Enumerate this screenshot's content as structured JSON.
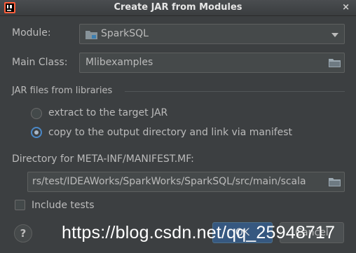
{
  "dialog": {
    "title": "Create JAR from Modules",
    "close_glyph": "×"
  },
  "module": {
    "label": "Module:",
    "value": "SparkSQL"
  },
  "main_class": {
    "label": "Main Class:",
    "value": "Mlibexamples"
  },
  "libraries": {
    "section_title": "JAR files from libraries",
    "options": [
      {
        "label": "extract to the target JAR",
        "selected": false
      },
      {
        "label": "copy to the output directory and link via manifest",
        "selected": true
      }
    ]
  },
  "manifest": {
    "label": "Directory for META-INF/MANIFEST.MF:",
    "value": "rs/test/IDEAWorks/SparkWorks/SparkSQL/src/main/scala"
  },
  "include_tests": {
    "label": "Include tests",
    "checked": false
  },
  "footer": {
    "help": "?",
    "ok": "OK",
    "cancel": "Cancel"
  },
  "watermark": "https://blog.csdn.net/qq_25948717",
  "icons": [
    "intellij-icon",
    "module-folder-icon",
    "combo-arrow-icon",
    "folder-icon",
    "help-icon",
    "close-icon"
  ],
  "colors": {
    "background": "#3c3f41",
    "field": "#45494a",
    "accent": "#4a88c7",
    "ok_button": "#365880"
  }
}
